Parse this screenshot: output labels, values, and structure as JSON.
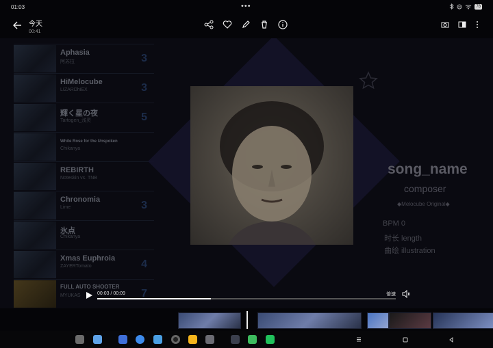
{
  "status_bar": {
    "time": "01:03",
    "dots": "•••",
    "battery": "78"
  },
  "header": {
    "title": "今天",
    "subtitle": "00:41"
  },
  "song_list": [
    {
      "title": "Aphasia",
      "composer": "阿苏拉",
      "level": "3"
    },
    {
      "title": "HiMelocube",
      "composer": "LIZARDhiEX",
      "level": "3"
    },
    {
      "title": "輝く星の夜",
      "composer": "Tartogen_浅灵",
      "level": "5"
    },
    {
      "title": "White Rose for the Unspoken",
      "composer": "Chikanya",
      "level": ""
    },
    {
      "title": "REBIRTH",
      "composer": "Noteskin vs. TNB",
      "level": ""
    },
    {
      "title": "Chronomia",
      "composer": "Lime",
      "level": "3"
    },
    {
      "title": "氷点",
      "composer": "Chikanya",
      "level": ""
    },
    {
      "title": "Xmas Euphroia",
      "composer": "ZAYERTomato",
      "level": "4"
    },
    {
      "title": "FULL AUTO SHOOTER",
      "composer": "MYUKAS",
      "level": "7"
    }
  ],
  "detail": {
    "song_name": "song_name",
    "composer": "composer",
    "origin": "◆Melocube Original◆",
    "bpm": "BPM  0",
    "length": "时长  length",
    "illustration": "曲绘  illustration"
  },
  "player": {
    "time": "00:03 / 00:09",
    "speed": "倍速",
    "progress_fraction": 0.38
  }
}
